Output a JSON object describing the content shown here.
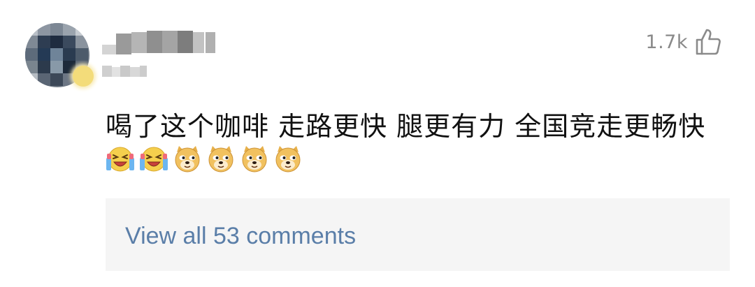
{
  "comment": {
    "like_count": "1.7k",
    "text": "喝了这个咖啡 走路更快 腿更有力  全国竞走更畅快",
    "emojis": [
      {
        "icon": "laughing-crying-emoji"
      },
      {
        "icon": "laughing-crying-emoji"
      },
      {
        "icon": "doge-emoji"
      },
      {
        "icon": "doge-emoji"
      },
      {
        "icon": "doge-emoji"
      },
      {
        "icon": "doge-emoji"
      }
    ],
    "view_all_label": "View all 53 comments"
  },
  "colors": {
    "like_count": "#8a8a8a",
    "view_all_text": "#5a7ea8",
    "view_all_background": "#f5f5f5"
  }
}
